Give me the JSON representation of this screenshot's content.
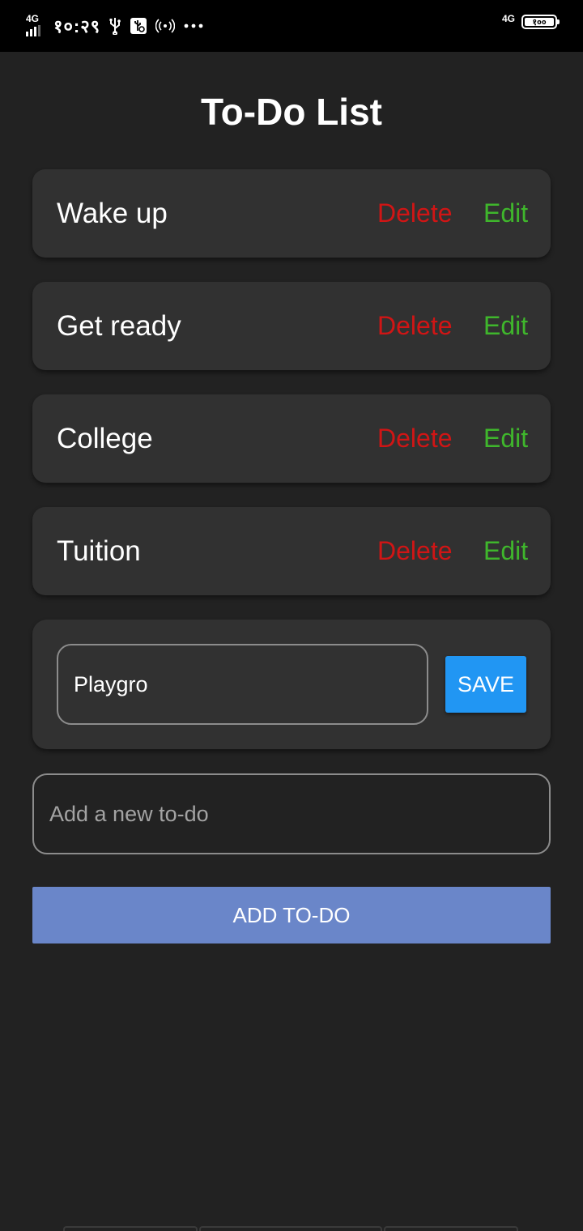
{
  "status_bar": {
    "network_left": "4G",
    "time": "१०:२९",
    "network_right": "4G",
    "battery": "१००",
    "battery_level": 1.0,
    "icons": [
      "signal-icon",
      "usb-icon",
      "usb-debug-icon",
      "hotspot-icon",
      "more-dots-icon",
      "battery-icon"
    ]
  },
  "title": "To-Do List",
  "todos": [
    {
      "text": "Wake up",
      "delete_label": "Delete",
      "edit_label": "Edit"
    },
    {
      "text": "Get ready",
      "delete_label": "Delete",
      "edit_label": "Edit"
    },
    {
      "text": "College",
      "delete_label": "Delete",
      "edit_label": "Edit"
    },
    {
      "text": "Tuition",
      "delete_label": "Delete",
      "edit_label": "Edit"
    }
  ],
  "edit_card": {
    "value": "Playgro",
    "save_label": "SAVE"
  },
  "new_todo": {
    "placeholder": "Add a new to-do",
    "value": ""
  },
  "add_button_label": "ADD TO-DO",
  "colors": {
    "background": "#222222",
    "card": "#313131",
    "delete": "#d01515",
    "edit": "#3fb62c",
    "save": "#2196f3",
    "add": "#6a86c9"
  }
}
